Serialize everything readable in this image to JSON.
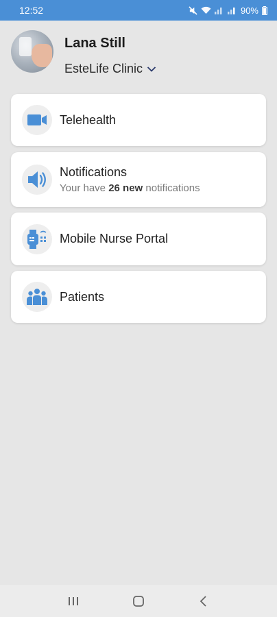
{
  "status_bar": {
    "time": "12:52",
    "battery": "90%"
  },
  "profile": {
    "name": "Lana Still",
    "clinic": "EsteLife Clinic"
  },
  "menu": {
    "telehealth": {
      "title": "Telehealth",
      "icon": "video-camera-icon"
    },
    "notifications": {
      "title": "Notifications",
      "subtitle_prefix": "Your have",
      "subtitle_count": "26 new",
      "subtitle_suffix": "notifications",
      "icon": "speaker-icon"
    },
    "nurse_portal": {
      "title": "Mobile Nurse Portal",
      "icon": "smartwatch-icon"
    },
    "patients": {
      "title": "Patients",
      "icon": "people-group-icon"
    }
  },
  "colors": {
    "accent": "#4a8fd6",
    "icon_blue": "#4a8fd6",
    "background": "#e6e6e6"
  },
  "nav": [
    "recent-apps",
    "home",
    "back"
  ]
}
